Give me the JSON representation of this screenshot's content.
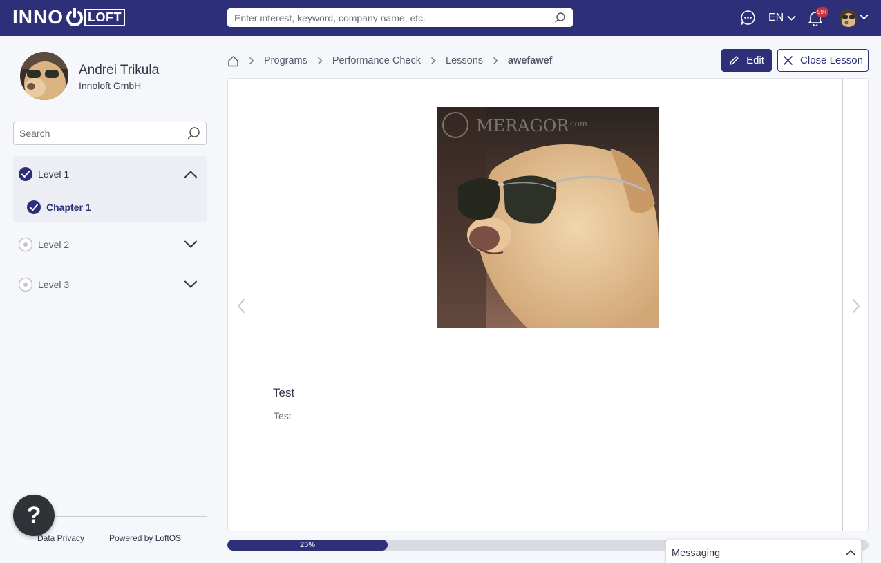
{
  "header": {
    "logo_left": "INNO",
    "logo_right": "LOFT",
    "search_placeholder": "Enter interest, keyword, company name, etc.",
    "language": "EN",
    "notification_badge": "99+",
    "icons": [
      "search-icon",
      "chat-icon",
      "chevron-down-icon",
      "bell-icon",
      "avatar"
    ]
  },
  "profile": {
    "name": "Andrei Trikula",
    "company": "Innoloft GmbH"
  },
  "sidebar": {
    "search_placeholder": "Search",
    "levels": [
      {
        "label": "Level 1",
        "status": "complete",
        "expanded": true,
        "chapters": [
          {
            "label": "Chapter 1",
            "status": "complete"
          }
        ]
      },
      {
        "label": "Level 2",
        "status": "incomplete",
        "expanded": false
      },
      {
        "label": "Level 3",
        "status": "incomplete",
        "expanded": false
      }
    ],
    "footer": {
      "privacy": "Data Privacy",
      "powered": "Powered by LoftOS"
    },
    "help_label": "?"
  },
  "breadcrumb": {
    "items": [
      "Programs",
      "Performance Check",
      "Lessons"
    ],
    "current": "awefawef"
  },
  "actions": {
    "edit_label": "Edit",
    "close_label": "Close Lesson"
  },
  "lesson": {
    "image_watermark": "MERAGOR",
    "image_watermark_suffix": ".com",
    "title": "Test",
    "text": "Test"
  },
  "progress": {
    "value": 0.25,
    "label": "25%"
  },
  "messaging": {
    "label": "Messaging"
  },
  "colors": {
    "primary": "#2d3078",
    "badge": "#c6343f",
    "background": "#f6f7fa"
  }
}
